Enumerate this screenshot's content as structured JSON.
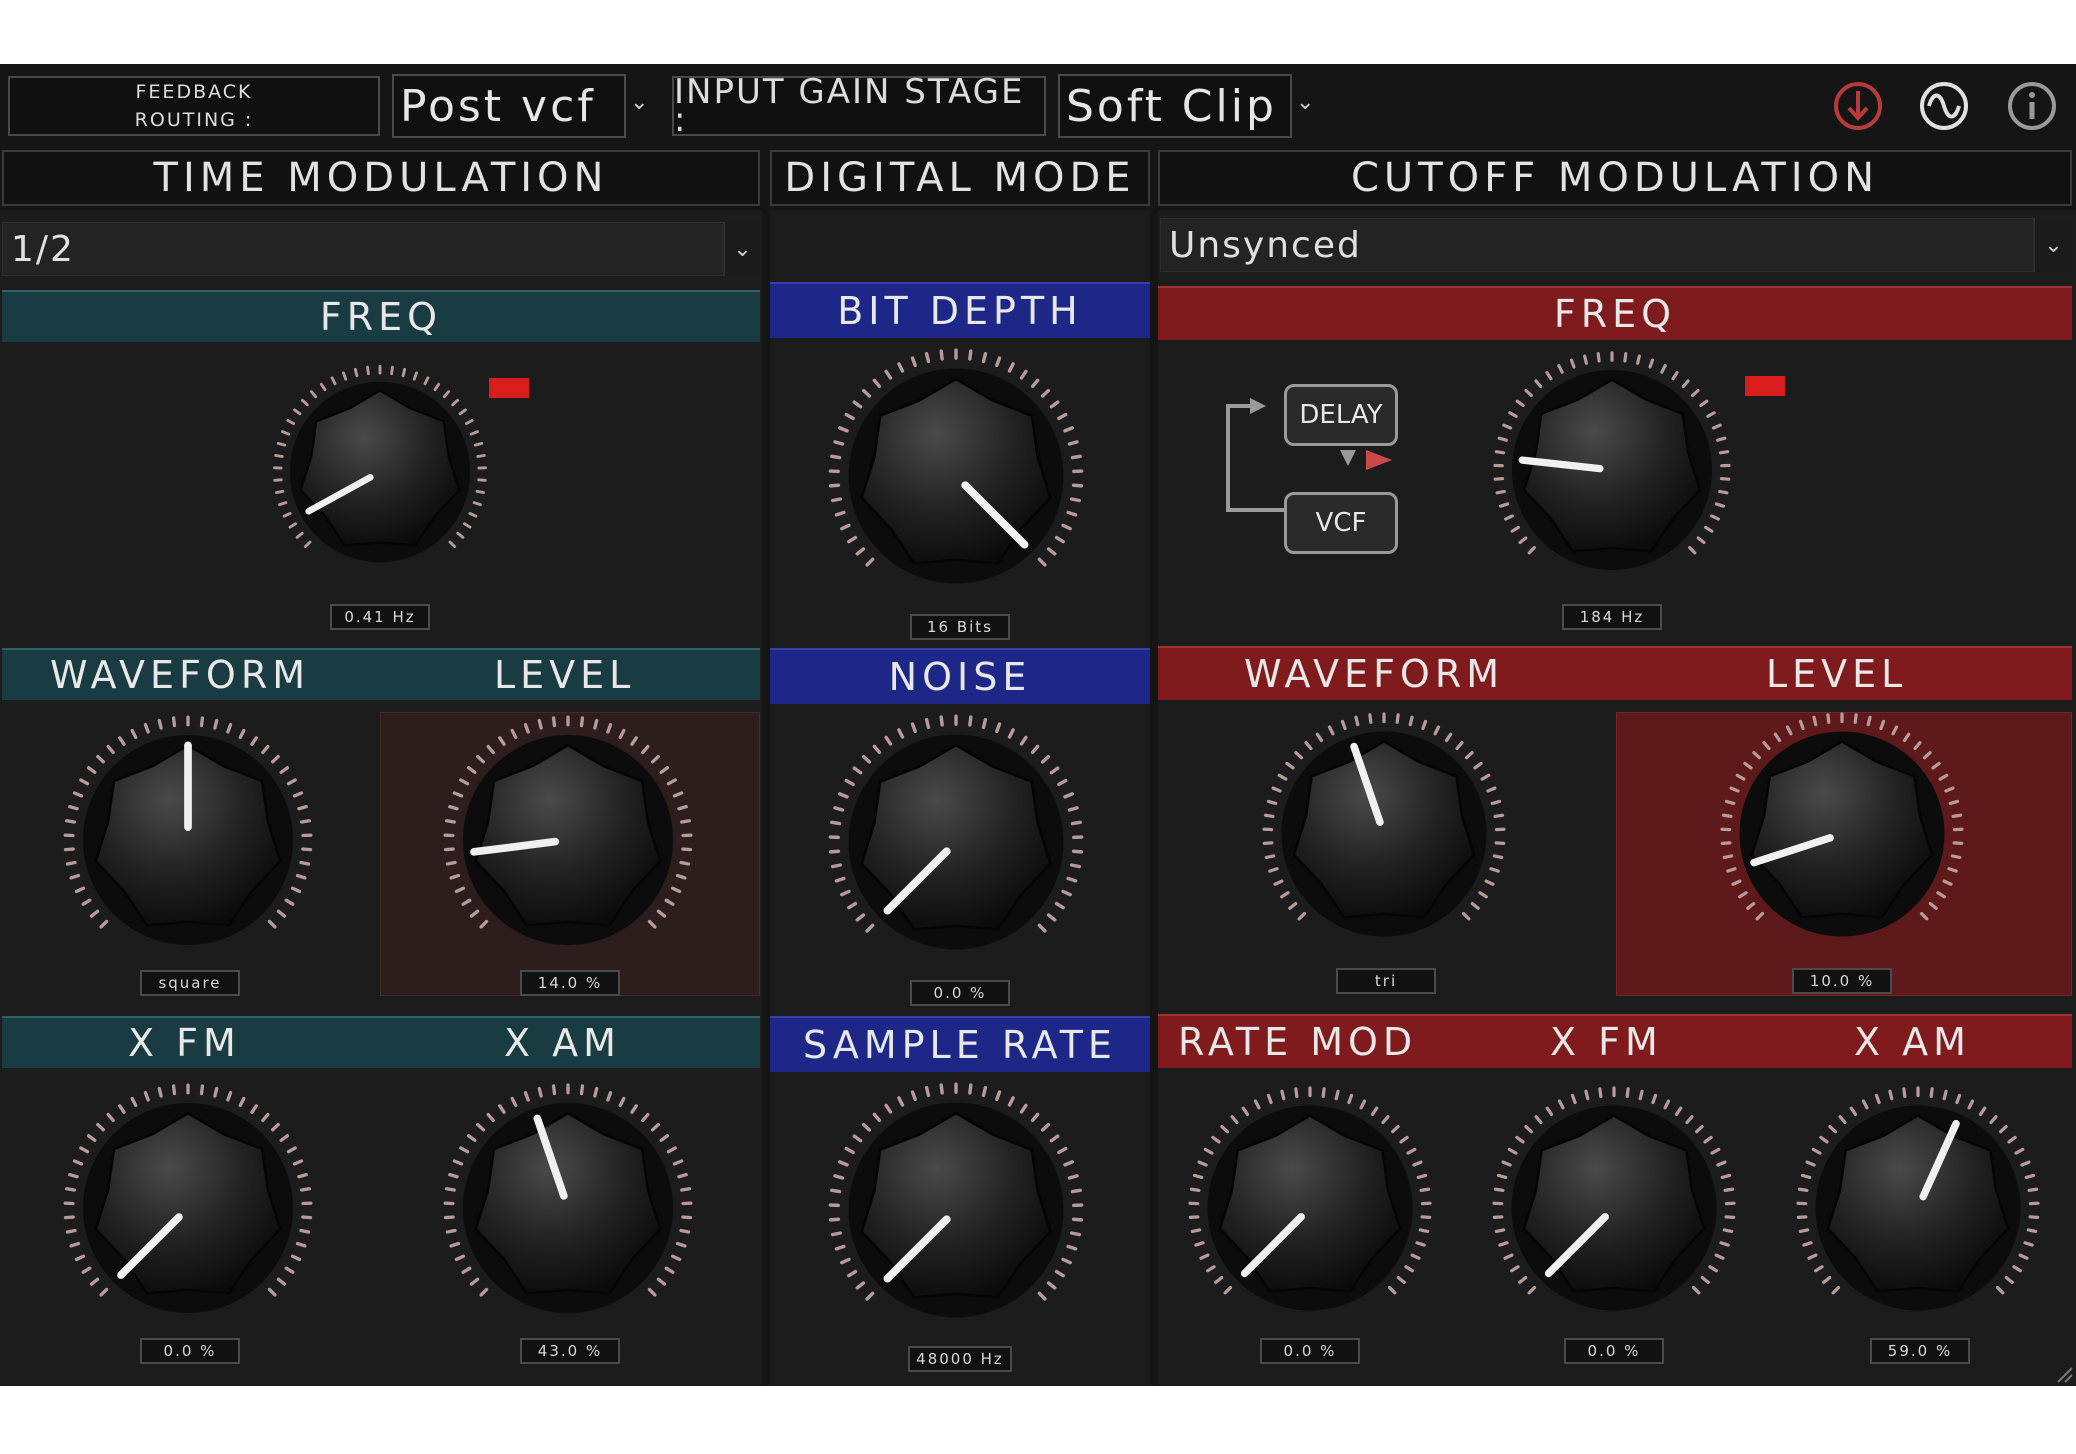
{
  "topbar": {
    "feedback_line1": "FEEDBACK",
    "feedback_line2": "ROUTING :",
    "feedback_value": "Post vcf",
    "input_gain_label": "INPUT GAIN STAGE :",
    "input_gain_value": "Soft Clip",
    "icons": [
      "download-icon",
      "sine-wave-icon",
      "info-icon"
    ]
  },
  "time_mod": {
    "title": "TIME MODULATION",
    "sync_value": "1/2",
    "freq": {
      "label": "FREQ",
      "value": "0.41 Hz",
      "level": 0.06
    },
    "waveform": {
      "label": "WAVEFORM",
      "value": "square",
      "level": 0.5
    },
    "level": {
      "label": "LEVEL",
      "value": "14.0 %",
      "level": 0.14
    },
    "xfm": {
      "label": "X FM",
      "value": "0.0 %",
      "level": 0.0
    },
    "xam": {
      "label": "X AM",
      "value": "43.0 %",
      "level": 0.43
    }
  },
  "digital": {
    "title": "DIGITAL MODE",
    "bit_depth": {
      "label": "BIT DEPTH",
      "value": "16 Bits",
      "level": 1.0
    },
    "noise": {
      "label": "NOISE",
      "value": "0.0 %",
      "level": 0.0
    },
    "sample_rate": {
      "label": "SAMPLE RATE",
      "value": "48000 Hz",
      "level": 0.0
    }
  },
  "cutoff_mod": {
    "title": "CUTOFF MODULATION",
    "sync_value": "Unsynced",
    "freq": {
      "label": "FREQ",
      "value": "184 Hz",
      "level": 0.19
    },
    "routing": {
      "delay": "DELAY",
      "vcf": "VCF"
    },
    "waveform": {
      "label": "WAVEFORM",
      "value": "tri",
      "level": 0.43
    },
    "level": {
      "label": "LEVEL",
      "value": "10.0 %",
      "level": 0.1
    },
    "rate_mod": {
      "label": "RATE MOD",
      "value": "0.0 %",
      "level": 0.0
    },
    "xfm": {
      "label": "X FM",
      "value": "0.0 %",
      "level": 0.0
    },
    "xam": {
      "label": "X AM",
      "value": "59.0 %",
      "level": 0.59
    }
  },
  "colors": {
    "teal": "#183c42",
    "blue": "#1d2787",
    "red": "#801b1d",
    "indicator": "#d81d1d"
  }
}
